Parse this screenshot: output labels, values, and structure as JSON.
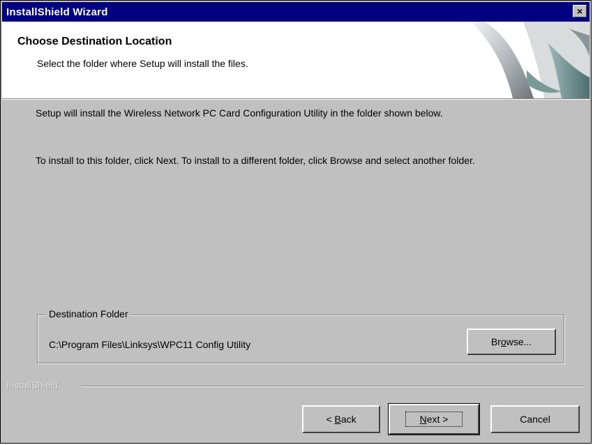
{
  "window": {
    "title": "InstallShield Wizard",
    "close_glyph": "×"
  },
  "header": {
    "heading": "Choose Destination Location",
    "subheading": "Select the folder where Setup will install the files.",
    "graphic_icon": "installshield-swoosh-icon"
  },
  "body": {
    "paragraph1": "Setup will install the Wireless Network PC Card Configuration Utility in the folder shown below.",
    "paragraph2": "To install to this folder, click Next. To install to a different folder, click Browse and select another folder."
  },
  "destination": {
    "legend": "Destination Folder",
    "path": "C:\\Program Files\\Linksys\\WPC11 Config Utility",
    "browse_pre": "Br",
    "browse_key": "o",
    "browse_post": "wse..."
  },
  "footer": {
    "brand": "InstallShield",
    "back_pre": "< ",
    "back_key": "B",
    "back_post": "ack",
    "next_key": "N",
    "next_post": "ext >",
    "cancel_label": "Cancel"
  },
  "colors": {
    "titlebar": "#000080",
    "dialog_face": "#c0c0c0",
    "header_bg": "#ffffff"
  }
}
